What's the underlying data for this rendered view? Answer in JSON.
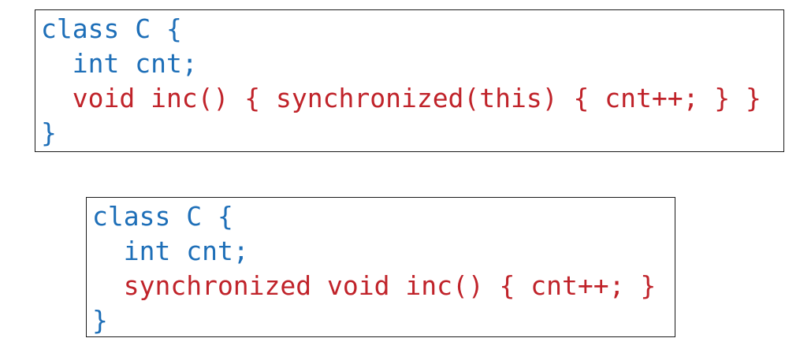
{
  "snippets": [
    {
      "lines": [
        {
          "text": "class C {",
          "color": "#1e6fb8"
        },
        {
          "text": "  int cnt;",
          "color": "#1e6fb8"
        },
        {
          "text": "  void inc() { synchronized(this) { cnt++; } }",
          "color": "#c0232a"
        },
        {
          "text": "}",
          "color": "#1e6fb8"
        }
      ]
    },
    {
      "lines": [
        {
          "text": "class C {",
          "color": "#1e6fb8"
        },
        {
          "text": "  int cnt;",
          "color": "#1e6fb8"
        },
        {
          "text": "  synchronized void inc() { cnt++; }",
          "color": "#c0232a"
        },
        {
          "text": "}",
          "color": "#1e6fb8"
        }
      ]
    }
  ]
}
